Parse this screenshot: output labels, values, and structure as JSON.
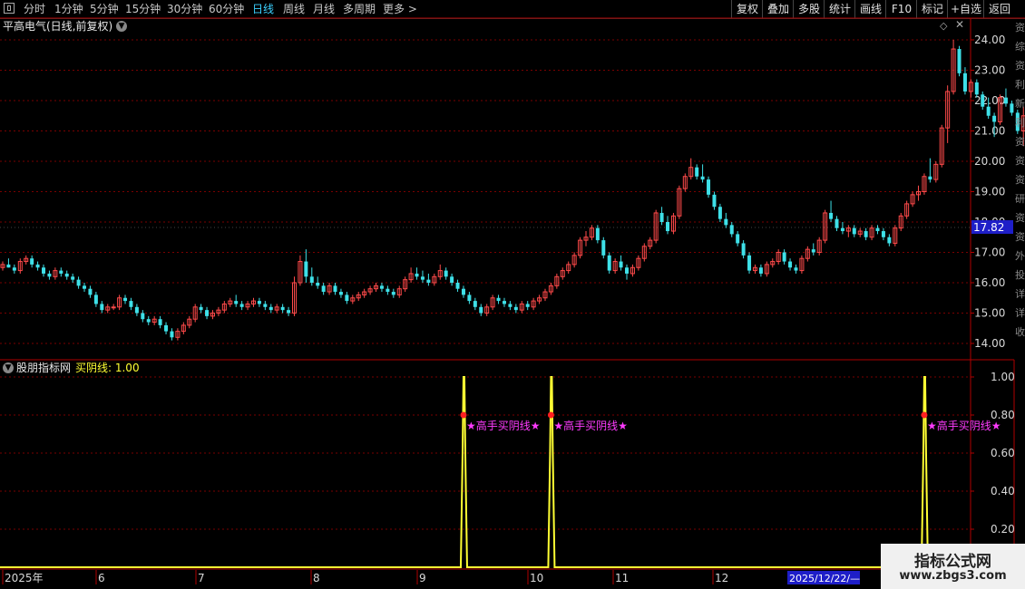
{
  "toolbar": {
    "periods": [
      {
        "label": "分时",
        "x": 26
      },
      {
        "label": "1分钟",
        "x": 60
      },
      {
        "label": "5分钟",
        "x": 99
      },
      {
        "label": "15分钟",
        "x": 138
      },
      {
        "label": "30分钟",
        "x": 184
      },
      {
        "label": "60分钟",
        "x": 230
      },
      {
        "label": "日线",
        "x": 278,
        "active": true
      },
      {
        "label": "周线",
        "x": 312
      },
      {
        "label": "月线",
        "x": 345
      },
      {
        "label": "多周期",
        "x": 378
      },
      {
        "label": "更多 >",
        "x": 422
      }
    ],
    "right_buttons": [
      {
        "label": "复权"
      },
      {
        "label": "叠加"
      },
      {
        "label": "多股"
      },
      {
        "label": "统计"
      },
      {
        "label": "画线"
      },
      {
        "label": "F10"
      },
      {
        "label": "标记"
      },
      {
        "label": "+自选"
      },
      {
        "label": "返回"
      }
    ]
  },
  "main_chart": {
    "title": "平高电气(日线,前复权)",
    "current_price_label": "17.82",
    "current_price": 17.82,
    "y_ticks": [
      "24.00",
      "23.00",
      "22.00",
      "21.00",
      "20.00",
      "19.00",
      "18.00",
      "17.00",
      "16.00",
      "15.00",
      "14.00"
    ],
    "y_range": [
      13.5,
      24.2
    ]
  },
  "indicator": {
    "name": "股朋指标网",
    "series_label": "买阴线: 1.00",
    "y_ticks": [
      "1.00",
      "0.80",
      "0.60",
      "0.40",
      "0.20"
    ],
    "signal_text": "★高手买阴线★",
    "signal_text_cut": "★高"
  },
  "x_axis": {
    "labels": [
      "2025年",
      "6",
      "7",
      "8",
      "9",
      "10",
      "11",
      "12"
    ],
    "cursor_label": "2025/12/22/—"
  },
  "watermark": {
    "line1": "指标公式网",
    "line2": "www.zbgs3.com"
  },
  "right_edge_chars": [
    "资",
    "综",
    "资",
    "利",
    "新",
    "利",
    "资",
    "资",
    "资",
    "研",
    "资",
    "资",
    "外",
    "投",
    "详",
    "详",
    "收"
  ],
  "colors": {
    "up": "#ff4a4a",
    "down": "#3ee0e8",
    "indicator_line": "#ffff33",
    "signal_text": "#ff3bff",
    "axis": "#b00000",
    "grid": "#7a0000",
    "cursor_label_bg": "#1e1ec8"
  },
  "chart_data": {
    "type": "candlestick",
    "candles": [
      [
        16.5,
        16.7,
        16.4,
        16.6
      ],
      [
        16.6,
        16.8,
        16.5,
        16.5
      ],
      [
        16.5,
        16.6,
        16.3,
        16.4
      ],
      [
        16.4,
        16.8,
        16.3,
        16.7
      ],
      [
        16.7,
        16.9,
        16.6,
        16.8
      ],
      [
        16.8,
        16.9,
        16.5,
        16.6
      ],
      [
        16.6,
        16.7,
        16.4,
        16.5
      ],
      [
        16.5,
        16.6,
        16.2,
        16.3
      ],
      [
        16.3,
        16.4,
        16.1,
        16.2
      ],
      [
        16.2,
        16.5,
        16.1,
        16.4
      ],
      [
        16.4,
        16.5,
        16.2,
        16.3
      ],
      [
        16.3,
        16.4,
        16.1,
        16.2
      ],
      [
        16.2,
        16.3,
        16.0,
        16.1
      ],
      [
        16.1,
        16.2,
        15.8,
        15.9
      ],
      [
        15.9,
        16.0,
        15.7,
        15.8
      ],
      [
        15.8,
        15.9,
        15.5,
        15.6
      ],
      [
        15.6,
        15.7,
        15.2,
        15.3
      ],
      [
        15.3,
        15.4,
        15.0,
        15.1
      ],
      [
        15.1,
        15.3,
        15.0,
        15.2
      ],
      [
        15.2,
        15.3,
        15.1,
        15.2
      ],
      [
        15.2,
        15.6,
        15.1,
        15.5
      ],
      [
        15.5,
        15.6,
        15.3,
        15.4
      ],
      [
        15.4,
        15.5,
        15.1,
        15.2
      ],
      [
        15.2,
        15.3,
        14.9,
        15.0
      ],
      [
        15.0,
        15.1,
        14.7,
        14.8
      ],
      [
        14.8,
        14.9,
        14.6,
        14.7
      ],
      [
        14.7,
        14.9,
        14.6,
        14.8
      ],
      [
        14.8,
        14.9,
        14.5,
        14.6
      ],
      [
        14.6,
        14.7,
        14.3,
        14.4
      ],
      [
        14.4,
        14.5,
        14.1,
        14.2
      ],
      [
        14.2,
        14.5,
        14.1,
        14.4
      ],
      [
        14.4,
        14.7,
        14.3,
        14.6
      ],
      [
        14.6,
        14.9,
        14.5,
        14.8
      ],
      [
        14.8,
        15.3,
        14.7,
        15.2
      ],
      [
        15.2,
        15.3,
        15.0,
        15.1
      ],
      [
        15.1,
        15.2,
        14.8,
        14.9
      ],
      [
        14.9,
        15.1,
        14.8,
        15.0
      ],
      [
        15.0,
        15.2,
        14.9,
        15.1
      ],
      [
        15.1,
        15.4,
        15.0,
        15.3
      ],
      [
        15.3,
        15.5,
        15.2,
        15.4
      ],
      [
        15.4,
        15.6,
        15.2,
        15.3
      ],
      [
        15.3,
        15.4,
        15.1,
        15.2
      ],
      [
        15.2,
        15.4,
        15.1,
        15.3
      ],
      [
        15.3,
        15.5,
        15.2,
        15.4
      ],
      [
        15.4,
        15.5,
        15.2,
        15.3
      ],
      [
        15.3,
        15.4,
        15.1,
        15.2
      ],
      [
        15.2,
        15.3,
        15.0,
        15.1
      ],
      [
        15.1,
        15.3,
        15.0,
        15.2
      ],
      [
        15.2,
        15.3,
        15.0,
        15.1
      ],
      [
        15.1,
        15.2,
        14.9,
        15.0
      ],
      [
        15.0,
        16.2,
        14.9,
        16.0
      ],
      [
        16.0,
        16.9,
        15.9,
        16.7
      ],
      [
        16.7,
        17.1,
        16.0,
        16.2
      ],
      [
        16.2,
        16.5,
        15.9,
        16.0
      ],
      [
        16.0,
        16.2,
        15.8,
        15.9
      ],
      [
        15.9,
        16.0,
        15.6,
        15.7
      ],
      [
        15.7,
        16.0,
        15.6,
        15.9
      ],
      [
        15.9,
        16.0,
        15.6,
        15.7
      ],
      [
        15.7,
        15.8,
        15.5,
        15.6
      ],
      [
        15.6,
        15.7,
        15.3,
        15.4
      ],
      [
        15.4,
        15.6,
        15.3,
        15.5
      ],
      [
        15.5,
        15.7,
        15.4,
        15.6
      ],
      [
        15.6,
        15.8,
        15.5,
        15.7
      ],
      [
        15.7,
        15.9,
        15.6,
        15.8
      ],
      [
        15.8,
        16.0,
        15.7,
        15.9
      ],
      [
        15.9,
        16.0,
        15.7,
        15.8
      ],
      [
        15.8,
        15.9,
        15.6,
        15.7
      ],
      [
        15.7,
        15.8,
        15.5,
        15.6
      ],
      [
        15.6,
        15.9,
        15.5,
        15.8
      ],
      [
        15.8,
        16.2,
        15.7,
        16.1
      ],
      [
        16.1,
        16.5,
        16.0,
        16.3
      ],
      [
        16.3,
        16.5,
        16.1,
        16.2
      ],
      [
        16.2,
        16.4,
        16.0,
        16.1
      ],
      [
        16.1,
        16.3,
        15.9,
        16.0
      ],
      [
        16.0,
        16.3,
        15.9,
        16.2
      ],
      [
        16.2,
        16.6,
        16.1,
        16.4
      ],
      [
        16.4,
        16.5,
        16.1,
        16.2
      ],
      [
        16.2,
        16.3,
        15.9,
        16.0
      ],
      [
        16.0,
        16.1,
        15.7,
        15.8
      ],
      [
        15.8,
        15.9,
        15.5,
        15.6
      ],
      [
        15.6,
        15.7,
        15.3,
        15.4
      ],
      [
        15.4,
        15.5,
        15.1,
        15.2
      ],
      [
        15.2,
        15.3,
        14.9,
        15.0
      ],
      [
        15.0,
        15.3,
        14.9,
        15.2
      ],
      [
        15.2,
        15.6,
        15.1,
        15.5
      ],
      [
        15.5,
        15.6,
        15.3,
        15.4
      ],
      [
        15.4,
        15.5,
        15.2,
        15.3
      ],
      [
        15.3,
        15.4,
        15.1,
        15.2
      ],
      [
        15.2,
        15.3,
        15.0,
        15.1
      ],
      [
        15.1,
        15.4,
        15.0,
        15.3
      ],
      [
        15.3,
        15.4,
        15.1,
        15.2
      ],
      [
        15.2,
        15.5,
        15.1,
        15.4
      ],
      [
        15.4,
        15.6,
        15.3,
        15.5
      ],
      [
        15.5,
        15.8,
        15.4,
        15.7
      ],
      [
        15.7,
        16.0,
        15.6,
        15.9
      ],
      [
        15.9,
        16.3,
        15.8,
        16.2
      ],
      [
        16.2,
        16.5,
        16.1,
        16.4
      ],
      [
        16.4,
        16.7,
        16.3,
        16.6
      ],
      [
        16.6,
        17.0,
        16.5,
        16.9
      ],
      [
        16.9,
        17.5,
        16.8,
        17.4
      ],
      [
        17.4,
        17.7,
        17.2,
        17.5
      ],
      [
        17.5,
        17.9,
        17.4,
        17.8
      ],
      [
        17.8,
        17.9,
        17.3,
        17.4
      ],
      [
        17.4,
        17.5,
        16.8,
        16.9
      ],
      [
        16.9,
        17.0,
        16.3,
        16.4
      ],
      [
        16.4,
        16.8,
        16.3,
        16.7
      ],
      [
        16.7,
        16.9,
        16.4,
        16.5
      ],
      [
        16.5,
        16.6,
        16.1,
        16.3
      ],
      [
        16.3,
        16.6,
        16.2,
        16.5
      ],
      [
        16.5,
        16.9,
        16.4,
        16.8
      ],
      [
        16.8,
        17.3,
        16.7,
        17.2
      ],
      [
        17.2,
        17.5,
        17.1,
        17.4
      ],
      [
        17.4,
        18.4,
        17.3,
        18.3
      ],
      [
        18.3,
        18.5,
        17.9,
        18.0
      ],
      [
        18.0,
        18.2,
        17.6,
        17.7
      ],
      [
        17.7,
        18.3,
        17.6,
        18.2
      ],
      [
        18.2,
        19.2,
        18.1,
        19.1
      ],
      [
        19.1,
        19.6,
        19.0,
        19.5
      ],
      [
        19.5,
        20.1,
        19.4,
        19.8
      ],
      [
        19.8,
        19.9,
        19.4,
        19.5
      ],
      [
        19.5,
        19.9,
        19.3,
        19.4
      ],
      [
        19.4,
        19.5,
        18.8,
        18.9
      ],
      [
        18.9,
        19.0,
        18.4,
        18.5
      ],
      [
        18.5,
        18.6,
        18.0,
        18.1
      ],
      [
        18.1,
        18.3,
        17.8,
        17.9
      ],
      [
        17.9,
        18.0,
        17.5,
        17.6
      ],
      [
        17.6,
        17.7,
        17.2,
        17.3
      ],
      [
        17.3,
        17.4,
        16.8,
        16.9
      ],
      [
        16.9,
        17.0,
        16.3,
        16.4
      ],
      [
        16.4,
        16.6,
        16.3,
        16.5
      ],
      [
        16.5,
        16.6,
        16.2,
        16.3
      ],
      [
        16.3,
        16.7,
        16.2,
        16.6
      ],
      [
        16.6,
        16.8,
        16.5,
        16.7
      ],
      [
        16.7,
        17.1,
        16.6,
        17.0
      ],
      [
        17.0,
        17.1,
        16.6,
        16.7
      ],
      [
        16.7,
        16.8,
        16.4,
        16.5
      ],
      [
        16.5,
        16.6,
        16.3,
        16.4
      ],
      [
        16.4,
        16.9,
        16.3,
        16.8
      ],
      [
        16.8,
        17.2,
        16.7,
        17.1
      ],
      [
        17.1,
        17.3,
        16.9,
        17.0
      ],
      [
        17.0,
        17.5,
        16.9,
        17.4
      ],
      [
        17.4,
        18.4,
        17.3,
        18.3
      ],
      [
        18.3,
        18.7,
        18.0,
        18.1
      ],
      [
        18.1,
        18.2,
        17.7,
        17.8
      ],
      [
        17.8,
        18.0,
        17.6,
        17.7
      ],
      [
        17.7,
        17.9,
        17.5,
        17.8
      ],
      [
        17.8,
        17.9,
        17.5,
        17.6
      ],
      [
        17.6,
        17.8,
        17.5,
        17.7
      ],
      [
        17.7,
        17.8,
        17.4,
        17.5
      ],
      [
        17.5,
        17.9,
        17.4,
        17.8
      ],
      [
        17.8,
        17.9,
        17.6,
        17.7
      ],
      [
        17.7,
        17.8,
        17.4,
        17.5
      ],
      [
        17.5,
        17.6,
        17.2,
        17.3
      ],
      [
        17.3,
        17.9,
        17.2,
        17.8
      ],
      [
        17.8,
        18.3,
        17.7,
        18.2
      ],
      [
        18.2,
        18.7,
        18.1,
        18.6
      ],
      [
        18.6,
        19.0,
        18.5,
        18.9
      ],
      [
        18.9,
        19.2,
        18.7,
        19.0
      ],
      [
        19.0,
        19.6,
        18.9,
        19.5
      ],
      [
        19.5,
        20.1,
        19.3,
        19.4
      ],
      [
        19.4,
        20.0,
        19.3,
        19.9
      ],
      [
        19.9,
        21.2,
        19.8,
        21.1
      ],
      [
        21.1,
        22.5,
        20.6,
        22.3
      ],
      [
        22.3,
        24.0,
        22.2,
        23.7
      ],
      [
        23.7,
        23.8,
        22.8,
        22.9
      ],
      [
        22.9,
        23.1,
        22.2,
        22.3
      ],
      [
        22.3,
        22.7,
        22.1,
        22.6
      ],
      [
        22.6,
        22.7,
        22.1,
        22.2
      ],
      [
        22.2,
        22.3,
        21.7,
        21.8
      ],
      [
        21.8,
        22.1,
        21.4,
        21.5
      ],
      [
        21.5,
        21.6,
        20.8,
        21.3
      ],
      [
        21.3,
        22.2,
        21.2,
        22.1
      ],
      [
        22.1,
        22.4,
        21.8,
        21.9
      ],
      [
        21.9,
        22.0,
        21.5,
        21.6
      ],
      [
        21.6,
        21.7,
        20.9,
        21.0
      ],
      [
        21.0,
        21.8,
        20.5,
        21.5
      ],
      [
        21.5,
        21.6,
        21.1,
        21.3
      ]
    ],
    "indicator_values": {
      "type": "line",
      "spike_bars": [
        79,
        94,
        158,
        184,
        226,
        270
      ],
      "spike_value": 1.0,
      "base_value": 0.0,
      "marker_value": 0.8
    }
  }
}
